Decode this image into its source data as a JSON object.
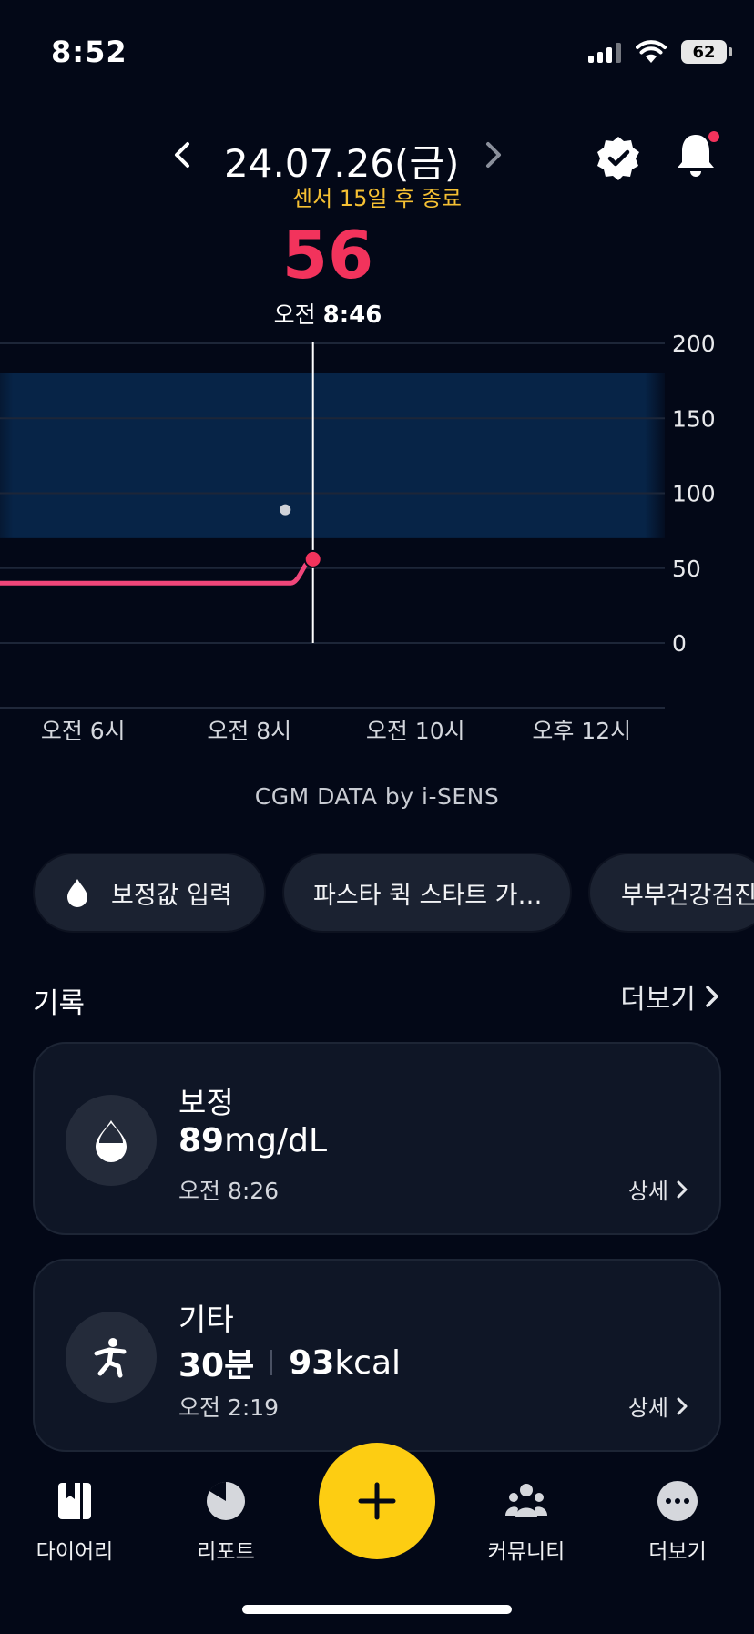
{
  "status": {
    "time": "8:52",
    "battery": "62"
  },
  "header": {
    "date": "24.07.26(금)",
    "sensor_note": "센서 15일 후 종료",
    "current_value": "56",
    "current_time_prefix": "오전",
    "current_time": "8:46"
  },
  "chart_data": {
    "type": "line",
    "y_ticks": [
      "200",
      "150",
      "100",
      "50",
      "0"
    ],
    "ylim": [
      0,
      200
    ],
    "target_range": [
      70,
      180
    ],
    "x_ticks": [
      "오전 6시",
      "오전 8시",
      "오전 10시",
      "오후 12시"
    ],
    "series": [
      {
        "x": [
          "05:00",
          "08:30",
          "08:46"
        ],
        "y": [
          40,
          40,
          56
        ]
      }
    ],
    "calibration_point": {
      "x": "08:26",
      "y": 89
    },
    "cursor_time": "08:46",
    "colors": {
      "line": "#f0467a",
      "range": "#072447",
      "point": "#f2335c"
    }
  },
  "credit": "CGM DATA by i-SENS",
  "chips": [
    {
      "label": "보정값 입력",
      "icon": "drop-icon"
    },
    {
      "label": "파스타 퀵 스타트 가…"
    },
    {
      "label": "부부건강검진"
    }
  ],
  "records": {
    "title": "기록",
    "more": "더보기",
    "items": [
      {
        "title": "보정",
        "value": "89",
        "unit": "mg/dL",
        "time": "오전 8:26",
        "detail": "상세",
        "icon": "drop-icon"
      },
      {
        "title": "기타",
        "value1": "30분",
        "value2": "93",
        "unit2": "kcal",
        "time": "오전 2:19",
        "detail": "상세",
        "icon": "exercise-icon"
      }
    ]
  },
  "nav": {
    "diary": "다이어리",
    "report": "리포트",
    "community": "커뮤니티",
    "more": "더보기"
  },
  "colors": {
    "accent": "#fdcd12",
    "alert": "#f2335c",
    "warning": "#f5c033",
    "background": "#030817"
  }
}
